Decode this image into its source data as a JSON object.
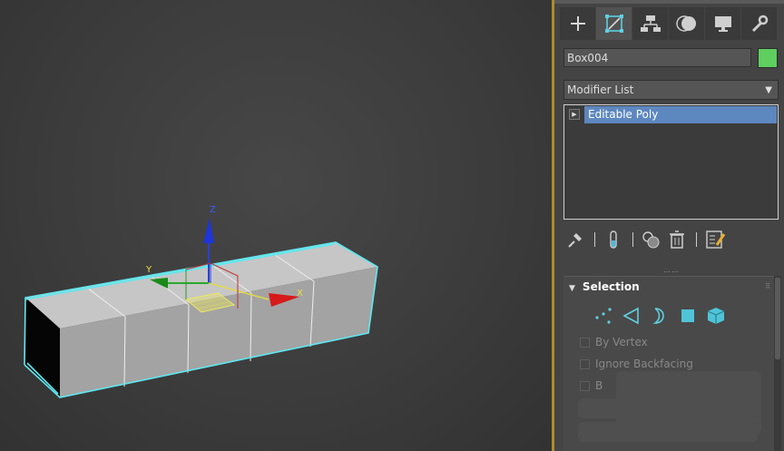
{
  "viewport": {
    "gizmo_labels": {
      "x": "X",
      "y": "Y",
      "z": "Z"
    }
  },
  "command_panel": {
    "tabs": [
      {
        "name": "create",
        "icon": "plus-icon"
      },
      {
        "name": "modify",
        "icon": "modify-icon",
        "active": true
      },
      {
        "name": "hierarchy",
        "icon": "hierarchy-icon"
      },
      {
        "name": "motion",
        "icon": "motion-icon"
      },
      {
        "name": "display",
        "icon": "display-icon"
      },
      {
        "name": "utilities",
        "icon": "wrench-icon"
      }
    ],
    "object_name": "Box004",
    "object_color": "#5ecf5e",
    "modifier_list_label": "Modifier List",
    "modifier_stack": [
      {
        "label": "Editable Poly",
        "selected": true
      }
    ],
    "selection_rollout": {
      "title": "Selection",
      "subobject_icons": [
        "vertex-icon",
        "edge-icon",
        "border-icon",
        "polygon-icon",
        "element-icon"
      ],
      "by_vertex": "By Vertex",
      "ignore_backfacing": "Ignore Backfacing",
      "partial_label": "B"
    }
  },
  "colors": {
    "accent_selected": "#5d87bf",
    "wireframe_highlight": "#5fe8f0",
    "divider": "#b08a2e"
  }
}
